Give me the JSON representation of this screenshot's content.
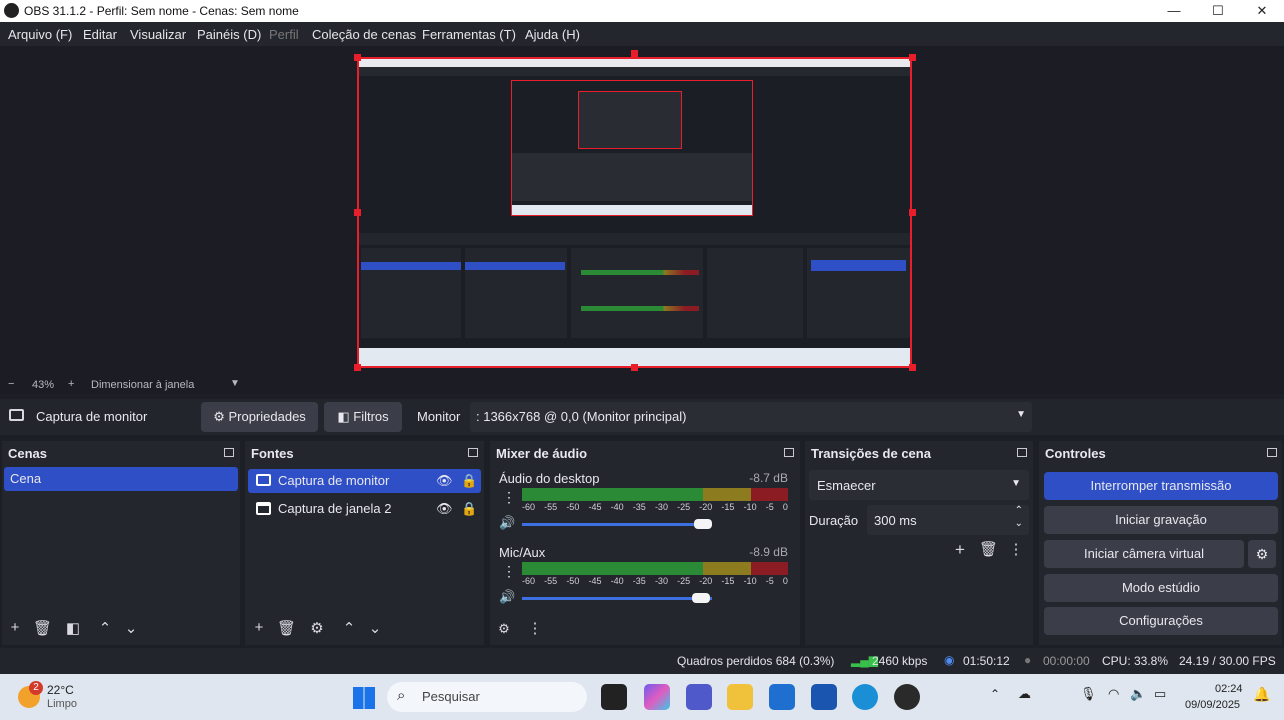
{
  "window": {
    "title": "OBS 31.1.2 - Perfil: Sem nome - Cenas: Sem nome",
    "controls": [
      "—",
      "☐",
      "✕"
    ]
  },
  "menu": [
    "Arquivo (F)",
    "Editar",
    "Visualizar",
    "Painéis (D)",
    "Perfil",
    "Coleção de cenas",
    "Ferramentas (T)",
    "Ajuda (H)"
  ],
  "zoom": {
    "minus": "−",
    "value": "43%",
    "plus": "+",
    "mode": "Dimensionar à janela"
  },
  "sourcebar": {
    "source_name": "Captura de monitor",
    "properties": "Propriedades",
    "filters": "Filtros",
    "monitor_label": "Monitor",
    "monitor_value": ": 1366x768 @ 0,0 (Monitor principal)"
  },
  "scenes": {
    "title": "Cenas",
    "items": [
      "Cena"
    ]
  },
  "sources": {
    "title": "Fontes",
    "items": [
      "Captura de monitor",
      "Captura de janela 2"
    ]
  },
  "mixer": {
    "title": "Mixer de áudio",
    "channels": [
      {
        "name": "Áudio do desktop",
        "db": "-8.7 dB",
        "volume": 0.95
      },
      {
        "name": "Mic/Aux",
        "db": "-8.9 dB",
        "volume": 0.94
      }
    ],
    "ticks": [
      "-60",
      "-55",
      "-50",
      "-45",
      "-40",
      "-35",
      "-30",
      "-25",
      "-20",
      "-15",
      "-10",
      "-5",
      "0"
    ]
  },
  "transitions": {
    "title": "Transições de cena",
    "selected": "Esmaecer",
    "duration_label": "Duração",
    "duration_value": "300 ms"
  },
  "controls": {
    "title": "Controles",
    "stop_stream": "Interromper transmissão",
    "start_recording": "Iniciar gravação",
    "start_virtual_cam": "Iniciar câmera virtual",
    "studio_mode": "Modo estúdio",
    "settings": "Configurações"
  },
  "status": {
    "dropped": "Quadros perdidos 684 (0.3%)",
    "bitrate": "2460 kbps",
    "stream_time": "01:50:12",
    "rec_time": "00:00:00",
    "cpu": "CPU: 33.8%",
    "fps": "24.19 / 30.00 FPS"
  },
  "taskbar": {
    "weather_temp": "22°C",
    "weather_desc": "Limpo",
    "weather_badge": "2",
    "search_placeholder": "Pesquisar",
    "time": "02:24",
    "date": "09/09/2025"
  },
  "colors": {
    "accent": "#2f4fc7",
    "selection_red": "#e81e2b",
    "panel": "#24262d"
  }
}
